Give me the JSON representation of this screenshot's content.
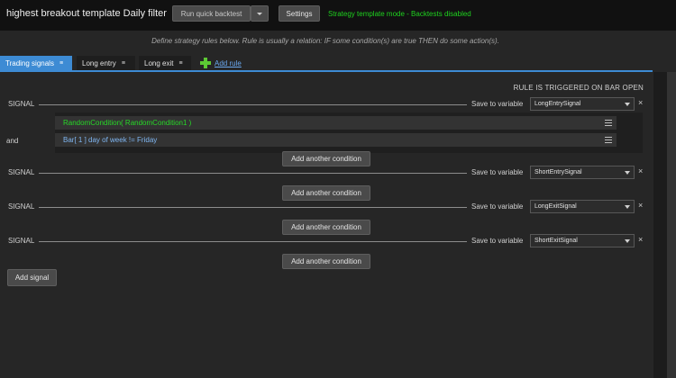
{
  "header": {
    "title": "highest breakout template Daily filter",
    "run_button": "Run quick backtest",
    "settings_button": "Settings",
    "mode_text": "Strategy template mode",
    "mode_separator": " - ",
    "mode_subtext": "Backtests disabled"
  },
  "instruction": "Define strategy rules below. Rule is usually a relation: IF some condition(s) are true THEN do some action(s).",
  "tabs": [
    {
      "label": "Trading signals",
      "active": true
    },
    {
      "label": "Long entry",
      "active": false
    },
    {
      "label": "Long exit",
      "active": false
    }
  ],
  "add_rule_label": "Add rule",
  "trigger_text": "RULE IS TRIGGERED ON BAR OPEN",
  "signals": [
    {
      "label": "SIGNAL",
      "save_label": "Save to variable",
      "variable": "LongEntrySignal",
      "add_condition": "Add another condition"
    },
    {
      "label": "SIGNAL",
      "save_label": "Save to variable",
      "variable": "ShortEntrySignal",
      "add_condition": "Add another condition"
    },
    {
      "label": "SIGNAL",
      "save_label": "Save to variable",
      "variable": "LongExitSignal",
      "add_condition": "Add another condition"
    },
    {
      "label": "SIGNAL",
      "save_label": "Save to variable",
      "variable": "ShortExitSignal",
      "add_condition": "Add another condition"
    }
  ],
  "conditions": [
    {
      "text": "RandomCondition( RandomCondition1 )"
    },
    {
      "prefix": "and",
      "text": "Bar[ 1 ] day of week != Friday"
    }
  ],
  "add_signal": "Add signal",
  "remove_glyph": "×",
  "tab_menu_glyph": "≡",
  "colors": {
    "accent": "#3d8bd4",
    "mode_green": "#1fd21f",
    "condition_green": "#27d827",
    "condition_blue": "#7fb6f2"
  }
}
